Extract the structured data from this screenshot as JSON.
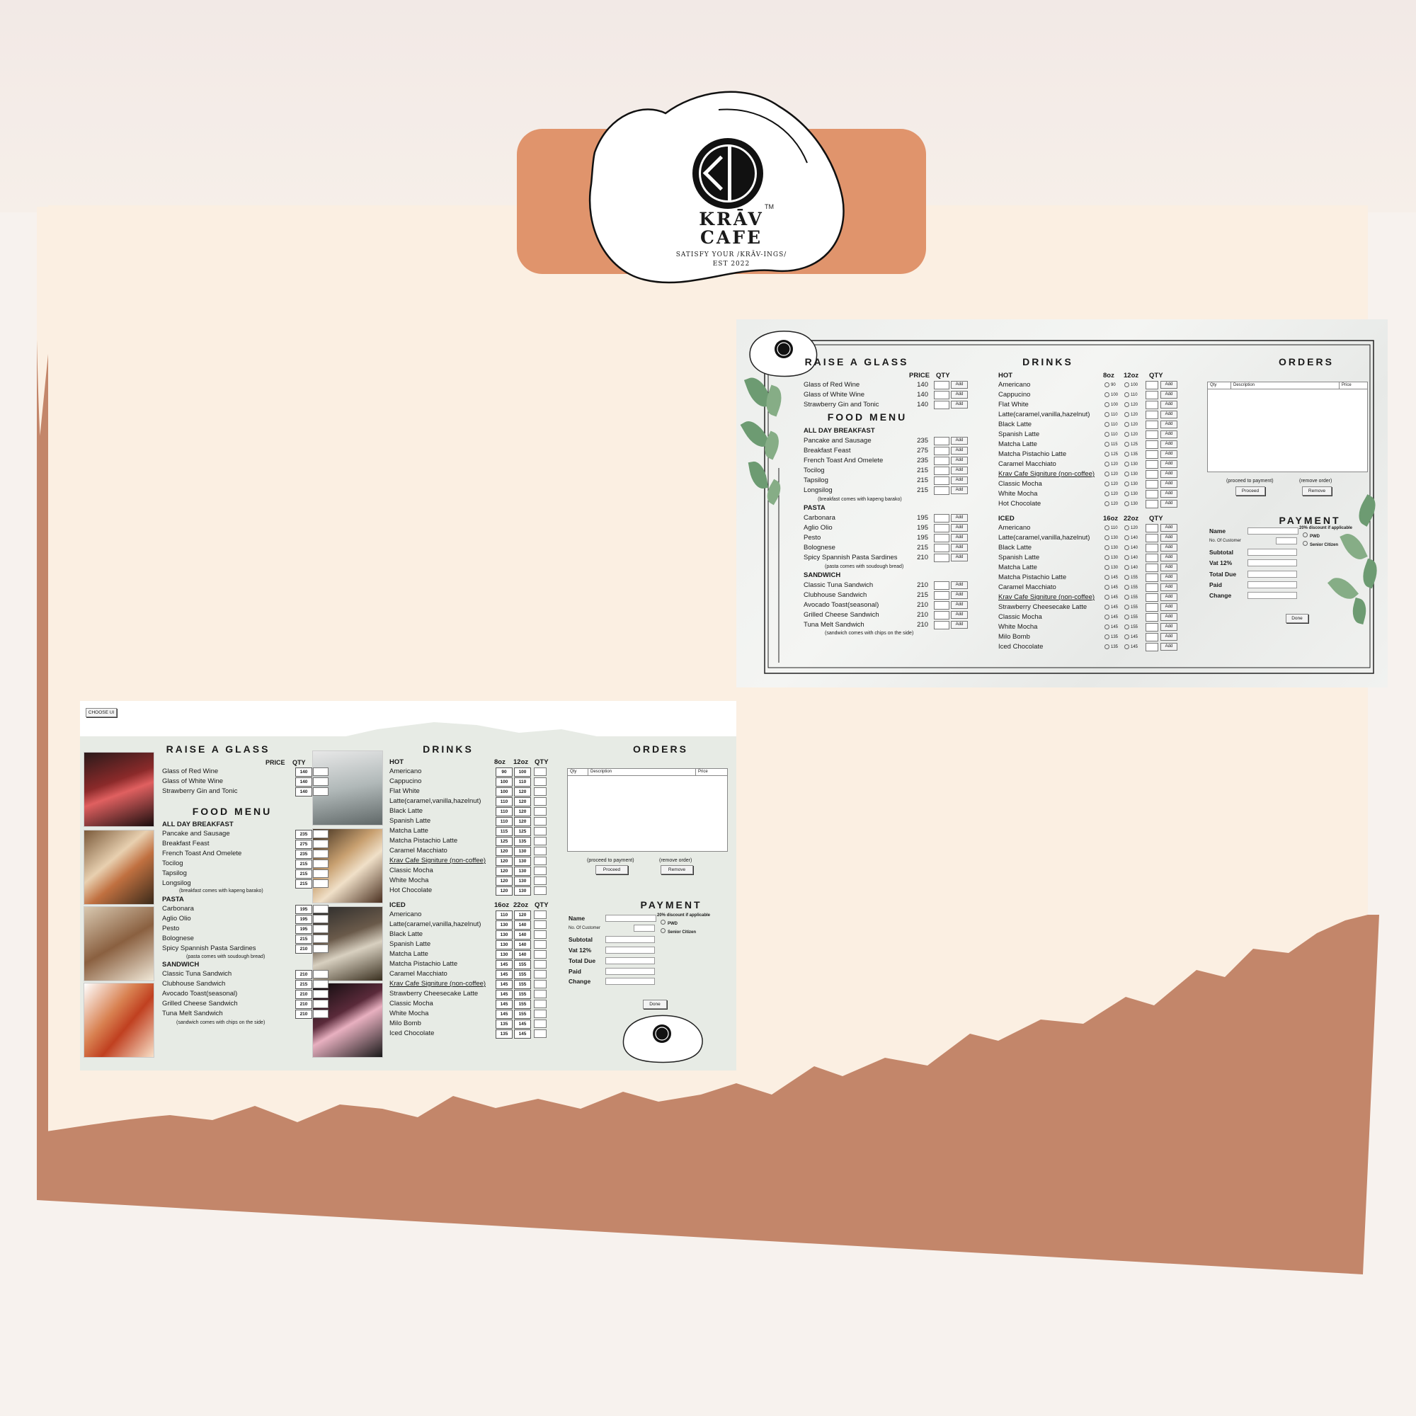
{
  "brand": {
    "name_line1": "KRĀV",
    "name_line2": "CAFE",
    "tm": "TM",
    "tagline": "SATISFY YOUR /KRĀV-INGS/",
    "est": "EST 2022"
  },
  "colors": {
    "accent": "#e0946c",
    "wave": "#c3866a",
    "cream": "#fbefe2"
  },
  "panel_a": {
    "choose_ui_label": "CHOOSE UI",
    "raise_title": "RAISE A GLASS",
    "price_label": "PRICE",
    "qty_label": "QTY",
    "wines": [
      {
        "name": "Glass of Red Wine",
        "price": "140"
      },
      {
        "name": "Glass of White Wine",
        "price": "140"
      },
      {
        "name": "Strawberry Gin and Tonic",
        "price": "140"
      }
    ],
    "food_title": "FOOD MENU",
    "breakfast_title": "ALL DAY BREAKFAST",
    "breakfast": [
      {
        "name": "Pancake and Sausage",
        "price": "235"
      },
      {
        "name": "Breakfast Feast",
        "price": "275"
      },
      {
        "name": "French Toast And Omelete",
        "price": "235"
      },
      {
        "name": "Tocilog",
        "price": "215"
      },
      {
        "name": "Tapsilog",
        "price": "215"
      },
      {
        "name": "Longsilog",
        "price": "215"
      }
    ],
    "breakfast_note": "(breakfast comes with kapeng barako)",
    "pasta_title": "PASTA",
    "pasta": [
      {
        "name": "Carbonara",
        "price": "195"
      },
      {
        "name": "Aglio Olio",
        "price": "195"
      },
      {
        "name": "Pesto",
        "price": "195"
      },
      {
        "name": "Bolognese",
        "price": "215"
      },
      {
        "name": "Spicy Spannish Pasta Sardines",
        "price": "210"
      }
    ],
    "pasta_note": "(pasta comes with soudough bread)",
    "sandwich_title": "SANDWICH",
    "sandwich": [
      {
        "name": "Classic Tuna Sandwich",
        "price": "210"
      },
      {
        "name": "Clubhouse Sandwich",
        "price": "215"
      },
      {
        "name": "Avocado Toast(seasonal)",
        "price": "210"
      },
      {
        "name": "Grilled Cheese Sandwich",
        "price": "210"
      },
      {
        "name": "Tuna Melt Sandwich",
        "price": "210"
      }
    ],
    "sandwich_note": "(sandwich comes with chips on the side)",
    "drinks_title": "DRINKS",
    "hot_label": "HOT",
    "size_hot_1": "8oz",
    "size_hot_2": "12oz",
    "size_iced_1": "16oz",
    "size_iced_2": "22oz",
    "hot": [
      {
        "name": "Americano",
        "a": "90",
        "b": "100"
      },
      {
        "name": "Cappucino",
        "a": "100",
        "b": "110"
      },
      {
        "name": "Flat White",
        "a": "100",
        "b": "120"
      },
      {
        "name": "Latte(caramel,vanilla,hazelnut)",
        "a": "110",
        "b": "120"
      },
      {
        "name": "Black Latte",
        "a": "110",
        "b": "120"
      },
      {
        "name": "Spanish Latte",
        "a": "110",
        "b": "120"
      },
      {
        "name": "Matcha Latte",
        "a": "115",
        "b": "125"
      },
      {
        "name": "Matcha Pistachio Latte",
        "a": "125",
        "b": "135"
      },
      {
        "name": "Caramel Macchiato",
        "a": "120",
        "b": "130"
      },
      {
        "name": "Krav Cafe Signiture (non-coffee)",
        "a": "120",
        "b": "130"
      },
      {
        "name": "Classic Mocha",
        "a": "120",
        "b": "130"
      },
      {
        "name": "White Mocha",
        "a": "120",
        "b": "130"
      },
      {
        "name": "Hot Chocolate",
        "a": "120",
        "b": "130"
      }
    ],
    "iced_label": "ICED",
    "iced": [
      {
        "name": "Americano",
        "a": "110",
        "b": "120"
      },
      {
        "name": "Latte(caramel,vanilla,hazelnut)",
        "a": "130",
        "b": "140"
      },
      {
        "name": "Black Latte",
        "a": "130",
        "b": "140"
      },
      {
        "name": "Spanish Latte",
        "a": "130",
        "b": "140"
      },
      {
        "name": "Matcha Latte",
        "a": "130",
        "b": "140"
      },
      {
        "name": "Matcha Pistachio Latte",
        "a": "145",
        "b": "155"
      },
      {
        "name": "Caramel Macchiato",
        "a": "145",
        "b": "155"
      },
      {
        "name": "Krav Cafe Signiture (non-coffee)",
        "a": "145",
        "b": "155"
      },
      {
        "name": "Strawberry Cheesecake Latte",
        "a": "145",
        "b": "155"
      },
      {
        "name": "Classic Mocha",
        "a": "145",
        "b": "155"
      },
      {
        "name": "White Mocha",
        "a": "145",
        "b": "155"
      },
      {
        "name": "Milo Bomb",
        "a": "135",
        "b": "145"
      },
      {
        "name": "Iced Chocolate",
        "a": "135",
        "b": "145"
      }
    ],
    "orders_title": "ORDERS",
    "col_qty": "Qty",
    "col_desc": "Description",
    "col_price": "Price",
    "proceed_hint": "(proceed to payment)",
    "remove_hint": "(remove order)",
    "proceed_label": "Proceed",
    "remove_label": "Remove",
    "payment_title": "PAYMENT",
    "name_label": "Name",
    "discount_label": "20% discount if applicable",
    "customers_label": "No. Of Customer",
    "pwd_label": "PWD",
    "senior_label": "Senior Citizen",
    "subtotal_label": "Subtotal",
    "vat_label": "Vat 12%",
    "total_label": "Total Due",
    "paid_label": "Paid",
    "change_label": "Change",
    "done_label": "Done",
    "add_label": "Add"
  }
}
